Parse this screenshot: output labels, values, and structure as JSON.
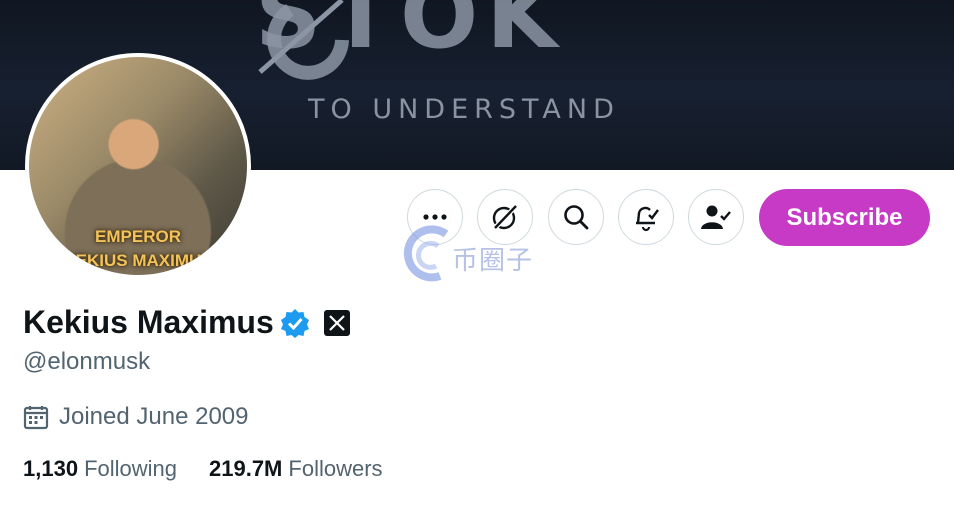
{
  "banner": {
    "big_text": "STOK",
    "sub_text": "TO UNDERSTAND"
  },
  "avatar": {
    "line1": "EMPEROR",
    "line2": "KEKIUS MAXIMUS"
  },
  "actions": {
    "more_icon": "more-icon",
    "grok_icon": "grok-icon",
    "search_icon": "search-icon",
    "notify_icon": "bell-check-icon",
    "following_icon": "person-check-icon",
    "subscribe_label": "Subscribe",
    "subscribe_color": "#c73ac6"
  },
  "watermark": {
    "text": "币圈子"
  },
  "profile": {
    "display_name": "Kekius Maximus",
    "verified_icon": "verified-badge-icon",
    "verified_color": "#1d9bf0",
    "affiliate_icon": "x-logo-icon",
    "handle": "@elonmusk",
    "joined": "Joined June 2009",
    "following_count": "1,130",
    "following_label": "Following",
    "followers_count": "219.7M",
    "followers_label": "Followers"
  }
}
